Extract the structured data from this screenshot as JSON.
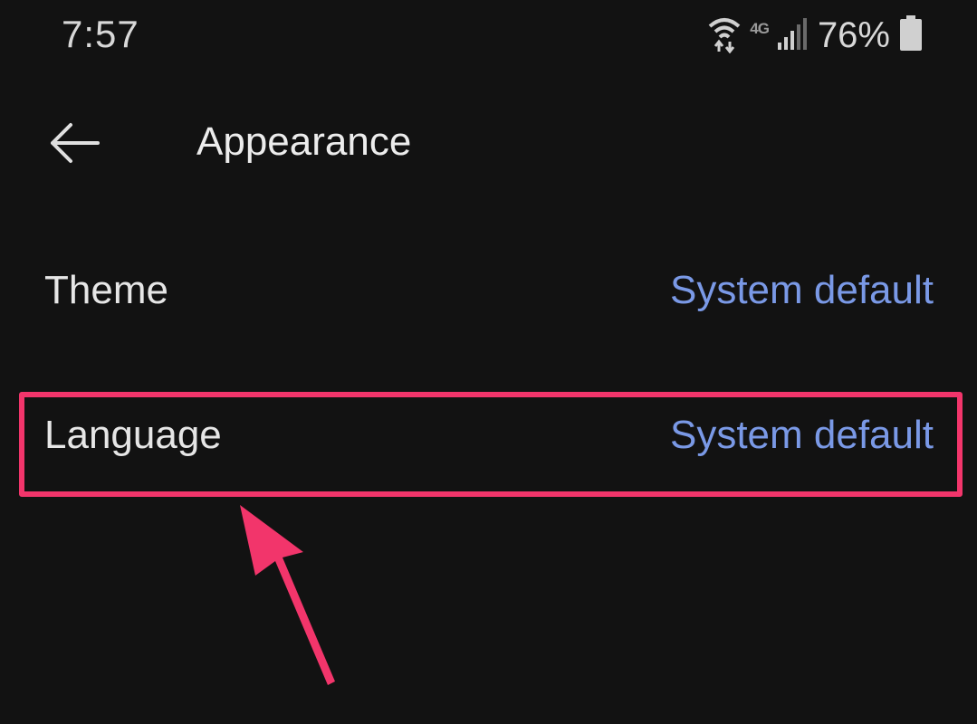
{
  "status_bar": {
    "time": "7:57",
    "network": "4G",
    "battery_percent": "76%",
    "icons": [
      "wifi-icon",
      "network-4g-icon",
      "signal-icon",
      "battery-icon"
    ]
  },
  "toolbar": {
    "back_icon": "arrow-left-icon",
    "title": "Appearance"
  },
  "settings": [
    {
      "label": "Theme",
      "value": "System default"
    },
    {
      "label": "Language",
      "value": "System default"
    }
  ],
  "colors": {
    "background": "#121212",
    "text": "#e6e6e6",
    "accent_value": "#7a99e6",
    "annotation": "#f2356b"
  },
  "annotation": {
    "highlighted_item": "Language",
    "arrow_icon": "pointer-arrow-icon"
  }
}
